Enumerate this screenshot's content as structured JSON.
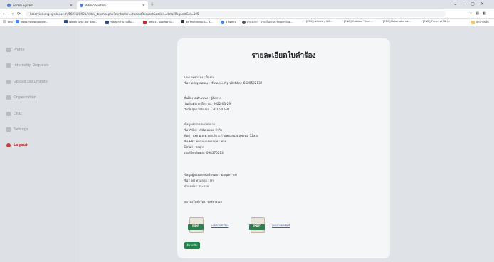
{
  "browser": {
    "tabs": [
      {
        "label": "Admin System"
      },
      {
        "label": "Admin System"
      }
    ],
    "url": "lisservice.eng.kps.ku.ac.th/6621UIUX21/index_teacher.php?controller=studentRequest&action=detailRequest&id=195",
    "bookmarks": [
      "test",
      "https://www.google...",
      "Watch Diya Aur Baa...",
      "รวมสูตรจำนวนเต็ม...",
      "Tanvi3 - ของศิษยาม...",
      "3d Photoshop CC a...",
      "8 ติดตาม",
      "คำแนะนำ",
      "เรนจ์ในระบบ Sniper/Sup...",
      "[END] Ashura / Vill...",
      "[END] Outdoor Time...",
      "[END] Sakamoto da...",
      "[END] Prince of Stri...",
      "บุ๊กมาร์กอื่น"
    ]
  },
  "sidebar": {
    "items": [
      {
        "label": "Profile"
      },
      {
        "label": "Internship Requests"
      },
      {
        "label": "Upload Documents"
      },
      {
        "label": "Organization"
      },
      {
        "label": "Chat"
      },
      {
        "label": "Settings"
      },
      {
        "label": "Logout"
      }
    ]
  },
  "detail": {
    "title": "รายละเอียดใบคำร้อง",
    "request_type": "ประเภทคำร้อง : ฝึกงาน",
    "student": "ชื่อ : หลักฐานตอน  : เรียนประเสริฐ รหัสนิสิต : 6620502132",
    "position": "ยื่นฝึกงานตำแหน่ง : ผู้จัดการ",
    "start_date": "วันเริ่มต้นการฝึกงาน : 2022-03-29",
    "end_date": "วันสิ้นสุดการฝึกงาน : 2022-03-31",
    "org_heading": "ข้อมูลสถานประกอบการ",
    "company": "ชื่อบริษัท : บริษัท ฝอบต จำกัด",
    "address": "ที่อยู่ : xxx ม.x ต.ลดกฎีบ อ.กำแพงแสน จ.สุพรรณ 72xxx",
    "hr": "ชื่อ HR : หวานบางนวลฤษ : ทาด",
    "email": "Email : สลยุกร",
    "phone": "เบอร์โทรติดต่อ : 098370213",
    "mentor_heading": "ข้อมูลผู้ขอออกหนังสือขอความอนุเคราะห์",
    "mentor_name": "ชื่อ : ดดี ทวมลกุล : ฟา",
    "mentor_position": "ตำแหน่ง : ประธาน",
    "status": "สถานะใบคำร้อง: รอพิจารณา",
    "pdf_icon_label": "PDF",
    "pdf1_link": "เอกสารคำร้อง",
    "pdf2_link": "เอกสารผลลัพธ์",
    "back_button": "ย้อนกลับ"
  }
}
